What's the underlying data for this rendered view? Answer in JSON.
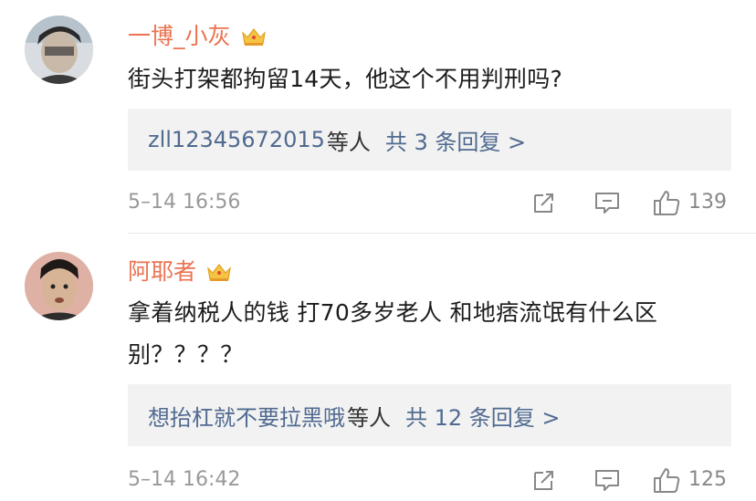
{
  "comments": [
    {
      "username": "一博_小灰",
      "text": "街头打架都拘留14天，他这个不用判刑吗?",
      "replies": {
        "who": "zll12345672015",
        "tail": "等人",
        "count": "共 3 条回复 >"
      },
      "time": "5–14 16:56",
      "likes": "139",
      "badge_icon": "crown-icon"
    },
    {
      "username": "阿耶者",
      "text": "拿着纳税人的钱 打70多岁老人 和地痞流氓有什么区别？？？？",
      "replies": {
        "who": "想抬杠就不要拉黑哦",
        "tail": "等人",
        "count": "共 12 条回复 >"
      },
      "time": "5–14 16:42",
      "likes": "125",
      "badge_icon": "crown-icon"
    }
  ],
  "colors": {
    "username": "#eb7350",
    "link": "#506a90",
    "meta": "#999999",
    "reply_bg": "#f2f2f2"
  }
}
